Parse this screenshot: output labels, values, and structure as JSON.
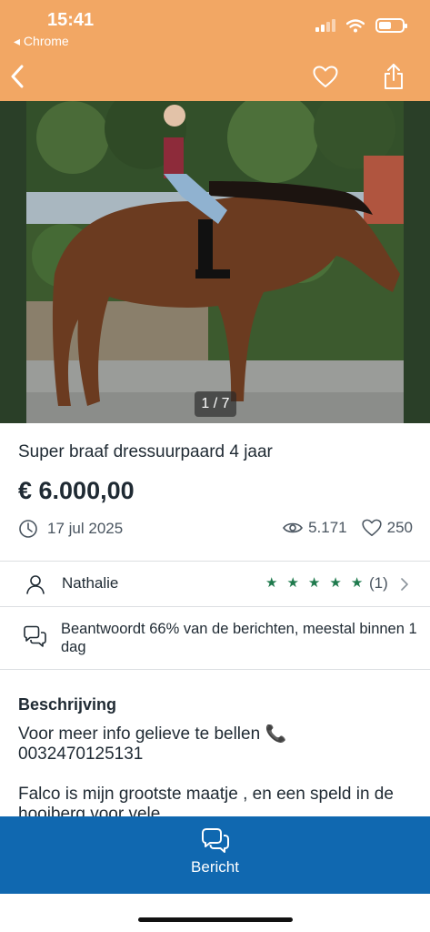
{
  "status_bar": {
    "time": "15:41",
    "back_app": "◂ Chrome",
    "battery_level": 0.55
  },
  "colors": {
    "header": "#f2a764",
    "accent_blue": "#1068b0",
    "star_green": "#1f7a4d"
  },
  "toolbar": {
    "back_icon": "chevron-left-icon",
    "favorite_icon": "heart-icon",
    "share_icon": "share-icon"
  },
  "gallery": {
    "counter": "1 / 7",
    "current": 1,
    "total": 7
  },
  "listing": {
    "title": "Super braaf dressuurpaard 4 jaar",
    "price": "€ 6.000,00",
    "date": "17 jul 2025",
    "views": "5.171",
    "favorites": "250"
  },
  "seller": {
    "name": "Nathalie",
    "stars": 5,
    "rating_count": "(1)"
  },
  "response": {
    "text": "Beantwoordt 66% van de berichten, meestal binnen 1 dag"
  },
  "description": {
    "heading": "Beschrijving",
    "line1": "Voor meer info gelieve te bellen 📞 0032470125131",
    "line2": "Falco is mijn grootste maatje , en een speld in de hooiberg voor vele"
  },
  "action": {
    "label": "Bericht",
    "icon": "chat-bubbles-icon"
  }
}
